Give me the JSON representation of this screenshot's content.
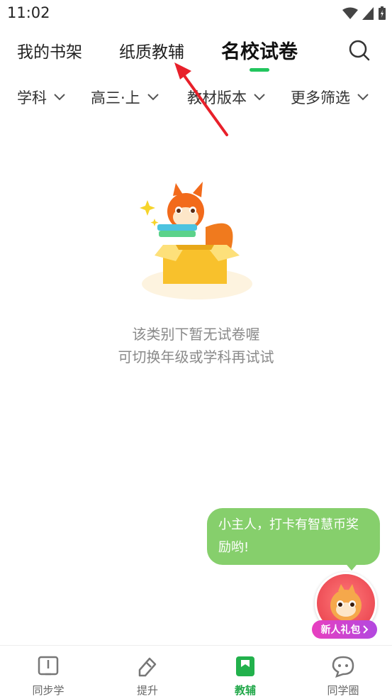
{
  "status_bar": {
    "time": "11:02"
  },
  "tabs": [
    {
      "label": "我的书架",
      "active": false
    },
    {
      "label": "纸质教辅",
      "active": false
    },
    {
      "label": "名校试卷",
      "active": true
    }
  ],
  "filters": [
    {
      "label": "学科"
    },
    {
      "label": "高三·上"
    },
    {
      "label": "教材版本"
    },
    {
      "label": "更多筛选"
    }
  ],
  "empty_state": {
    "line1": "该类别下暂无试卷喔",
    "line2": "可切换年级或学科再试试"
  },
  "promo_bubble": {
    "line1": "小主人，打卡有智慧币奖",
    "line2": "励哟!"
  },
  "gift_button": {
    "label": "新人礼包"
  },
  "bottom_nav": [
    {
      "label": "同步学",
      "icon": "book-icon",
      "active": false
    },
    {
      "label": "提升",
      "icon": "pencil-tag-icon",
      "active": false
    },
    {
      "label": "教辅",
      "icon": "bookmark-book-icon",
      "active": true
    },
    {
      "label": "同学圈",
      "icon": "chat-bubble-icon",
      "active": false
    }
  ],
  "colors": {
    "accent": "#22c55e",
    "bubble": "#86cf6c",
    "annotation_arrow": "#e8202a"
  }
}
